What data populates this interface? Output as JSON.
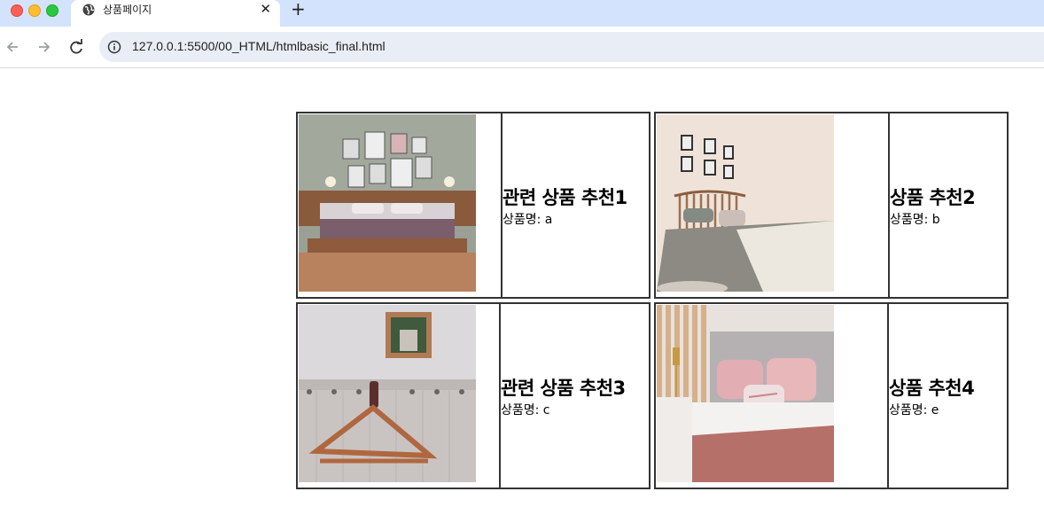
{
  "browser": {
    "tab_title": "상품페이지",
    "url": "127.0.0.1:5500/00_HTML/htmlbasic_final.html",
    "icons": {
      "favicon": "globe-icon",
      "close": "close-icon",
      "new_tab": "plus-icon",
      "back": "arrow-left-icon",
      "forward": "arrow-right-icon",
      "reload": "reload-icon",
      "info": "info-icon"
    }
  },
  "products": [
    {
      "title": "관련 상품 추천1",
      "name_label": "상품명: a",
      "image": "bedroom-gallery-wall-photo"
    },
    {
      "title": "상품 추천2",
      "name_label": "상품명: b",
      "image": "bedroom-knit-blanket-photo"
    },
    {
      "title": "관련 상품 추천3",
      "name_label": "상품명: c",
      "image": "wooden-hanger-on-wall-photo"
    },
    {
      "title": "상품 추천4",
      "name_label": "상품명: e",
      "image": "pink-pillows-bed-photo"
    }
  ]
}
